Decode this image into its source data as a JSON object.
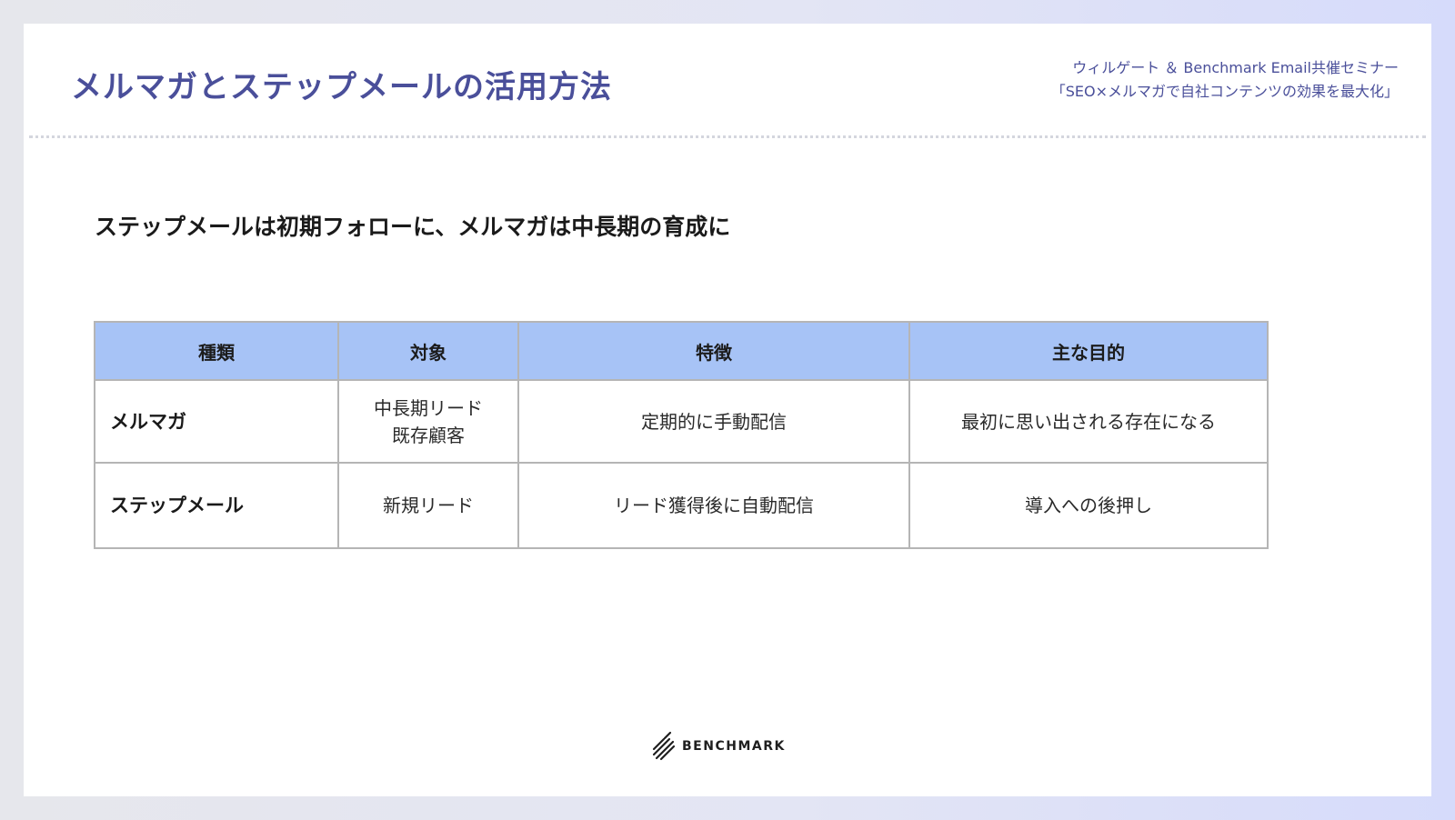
{
  "header": {
    "title": "メルマガとステップメールの活用方法",
    "seminar_line1": "ウィルゲート ＆ Benchmark Email共催セミナー",
    "seminar_line2": "「SEO×メルマガで自社コンテンツの効果を最大化」"
  },
  "main": {
    "subtitle": "ステップメールは初期フォローに、メルマガは中長期の育成に",
    "table": {
      "headers": [
        "種類",
        "対象",
        "特徴",
        "主な目的"
      ],
      "rows": [
        {
          "type": "メルマガ",
          "target": [
            "中長期リード",
            "既存顧客"
          ],
          "feature": "定期的に手動配信",
          "purpose": "最初に思い出される存在になる"
        },
        {
          "type": "ステップメール",
          "target": [
            "新規リード"
          ],
          "feature": "リード獲得後に自動配信",
          "purpose": "導入への後押し"
        }
      ]
    }
  },
  "footer": {
    "brand": "BENCHMARK",
    "logo_icon": "benchmark-logo-icon"
  },
  "colors": {
    "title": "#4a4f9a",
    "table_header_bg": "#a7c3f6",
    "table_border": "#b5b5b5"
  }
}
